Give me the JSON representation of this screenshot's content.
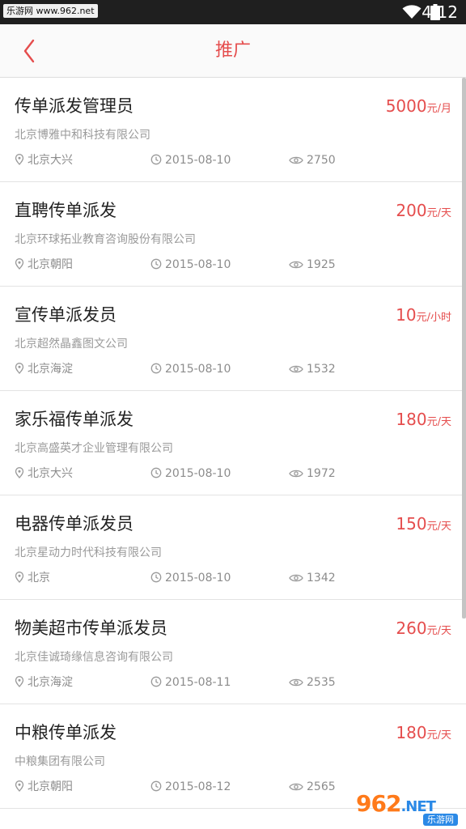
{
  "status_bar": {
    "watermark": "乐游网 www.962.net",
    "time": "4:12"
  },
  "header": {
    "title": "推广"
  },
  "jobs": [
    {
      "title": "传单派发管理员",
      "salary": "5000",
      "unit": "元/月",
      "company": "北京博雅中和科技有限公司",
      "location": "北京大兴",
      "date": "2015-08-10",
      "views": "2750"
    },
    {
      "title": "直聘传单派发",
      "salary": "200",
      "unit": "元/天",
      "company": "北京环球拓业教育咨询股份有限公司",
      "location": "北京朝阳",
      "date": "2015-08-10",
      "views": "1925"
    },
    {
      "title": "宣传单派发员",
      "salary": "10",
      "unit": "元/小时",
      "company": "北京超然晶鑫图文公司",
      "location": "北京海淀",
      "date": "2015-08-10",
      "views": "1532"
    },
    {
      "title": "家乐福传单派发",
      "salary": "180",
      "unit": "元/天",
      "company": "北京高盛英才企业管理有限公司",
      "location": "北京大兴",
      "date": "2015-08-10",
      "views": "1972"
    },
    {
      "title": "电器传单派发员",
      "salary": "150",
      "unit": "元/天",
      "company": "北京星动力时代科技有限公司",
      "location": "北京",
      "date": "2015-08-10",
      "views": "1342"
    },
    {
      "title": "物美超市传单派发员",
      "salary": "260",
      "unit": "元/天",
      "company": "北京佳诚琦缘信息咨询有限公司",
      "location": "北京海淀",
      "date": "2015-08-11",
      "views": "2535"
    },
    {
      "title": "中粮传单派发",
      "salary": "180",
      "unit": "元/天",
      "company": "中粮集团有限公司",
      "location": "北京朝阳",
      "date": "2015-08-12",
      "views": "2565"
    }
  ],
  "logo": {
    "main": "962",
    "suffix": ".NET",
    "sub": "乐游网"
  },
  "colors": {
    "accent": "#e54d4d",
    "status_bar": "#1f1f1f",
    "title_bar": "#fafafa"
  },
  "icons": {
    "back": "chevron-left-icon",
    "location": "location-pin-icon",
    "date": "clock-icon",
    "views": "eye-icon"
  }
}
